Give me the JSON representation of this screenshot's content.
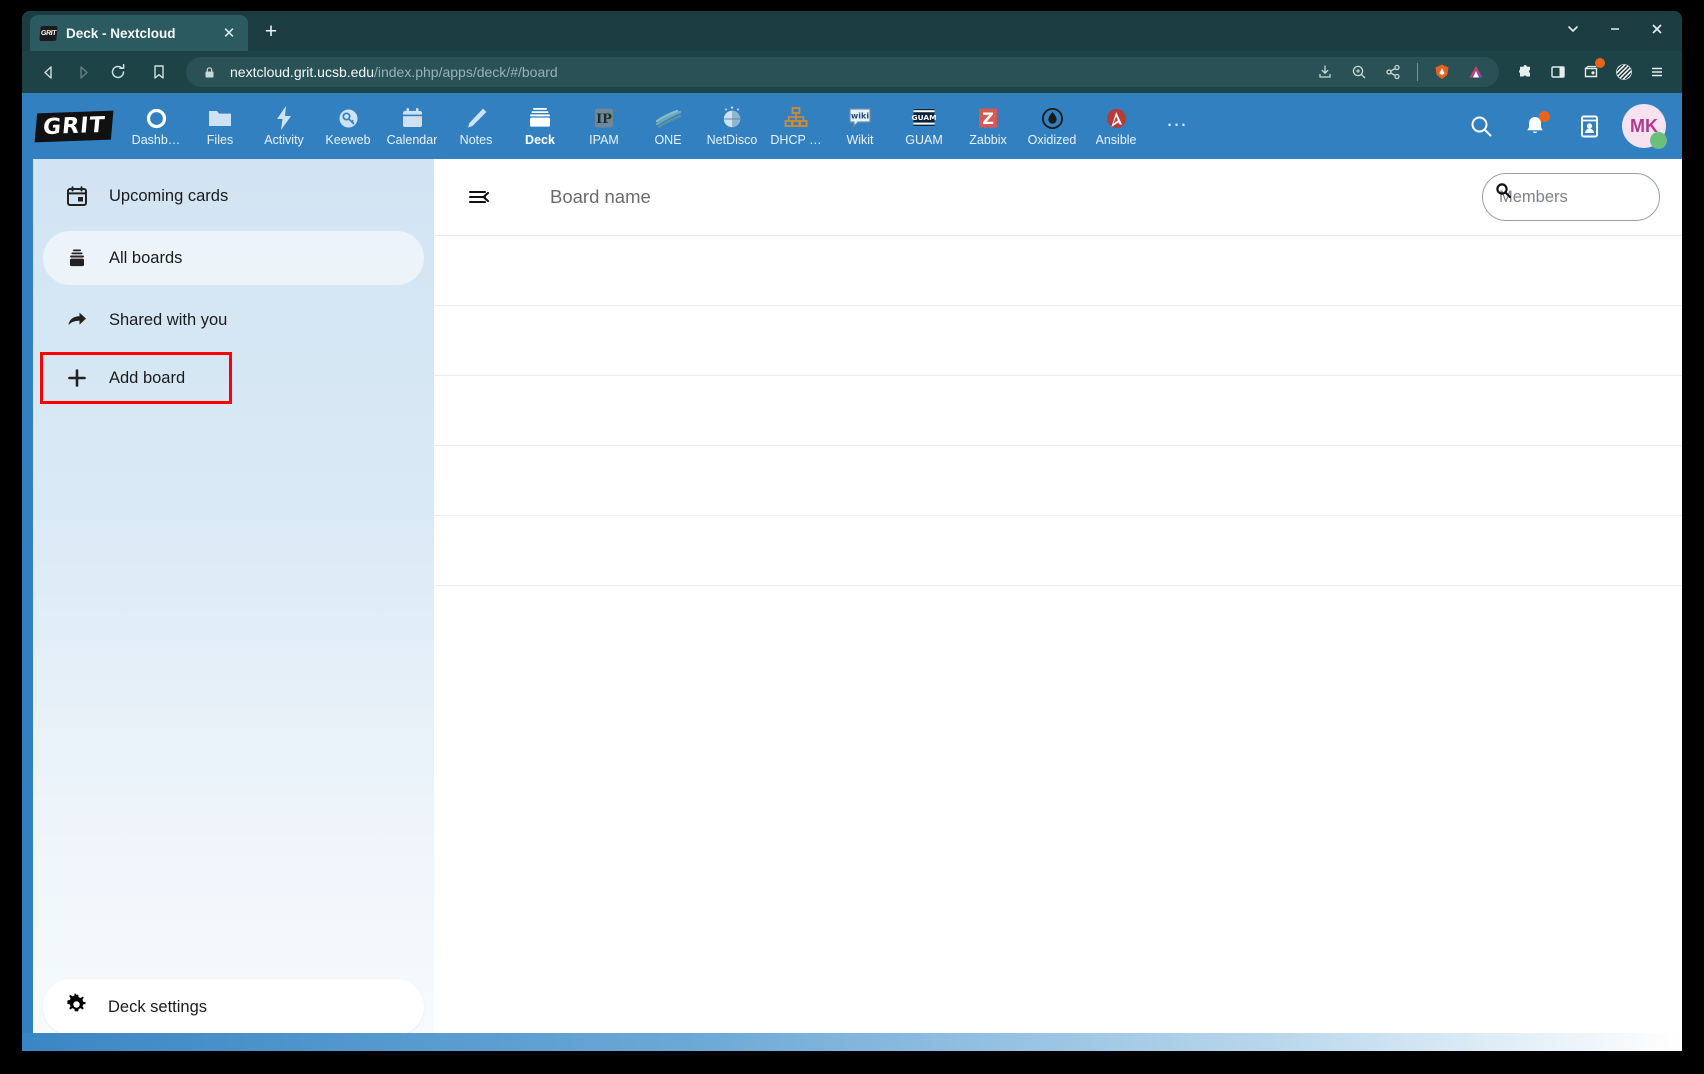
{
  "window": {
    "controls": {
      "expand": "⌄",
      "minimize": "—",
      "close": "✕"
    }
  },
  "browser": {
    "tab": {
      "favicon_text": "GRIT",
      "title": "Deck - Nextcloud",
      "close": "✕"
    },
    "new_tab_label": "+",
    "nav": {
      "back": "back-icon",
      "forward": "forward-icon",
      "reload": "reload-icon",
      "bookmark": "bookmark-icon"
    },
    "url": {
      "domain": "nextcloud.grit.ucsb.edu",
      "path": "/index.php/apps/deck/#/board",
      "lock": "lock-icon"
    },
    "url_actions": [
      "install-icon",
      "zoom-icon",
      "share-icon",
      "brave-rewards-icon",
      "brave-shields-icon"
    ],
    "toolbar_icons": [
      "extensions-icon",
      "sidebar-icon",
      "wallet-icon",
      "leo-icon",
      "menu-icon"
    ]
  },
  "nextcloud": {
    "logo": "GRIT",
    "apps": [
      {
        "label": "Dashb…",
        "icon": "dashboard-icon",
        "active": false
      },
      {
        "label": "Files",
        "icon": "files-icon",
        "active": false
      },
      {
        "label": "Activity",
        "icon": "activity-icon",
        "active": false
      },
      {
        "label": "Keeweb",
        "icon": "keeweb-icon",
        "active": false
      },
      {
        "label": "Calendar",
        "icon": "calendar-icon",
        "active": false
      },
      {
        "label": "Notes",
        "icon": "notes-icon",
        "active": false
      },
      {
        "label": "Deck",
        "icon": "deck-icon",
        "active": true
      },
      {
        "label": "IPAM",
        "icon": "ipam-icon",
        "active": false
      },
      {
        "label": "ONE",
        "icon": "one-icon",
        "active": false
      },
      {
        "label": "NetDisco",
        "icon": "netdisco-icon",
        "active": false
      },
      {
        "label": "DHCP …",
        "icon": "dhcp-icon",
        "active": false
      },
      {
        "label": "Wikit",
        "icon": "wikit-icon",
        "active": false
      },
      {
        "label": "GUAM",
        "icon": "guam-icon",
        "active": false
      },
      {
        "label": "Zabbix",
        "icon": "zabbix-icon",
        "active": false
      },
      {
        "label": "Oxidized",
        "icon": "oxidized-icon",
        "active": false
      },
      {
        "label": "Ansible",
        "icon": "ansible-icon",
        "active": false
      }
    ],
    "more_apps": "…",
    "header_right": {
      "search": "search-icon",
      "notifications": "bell-icon",
      "contacts": "contacts-icon",
      "avatar_initials": "MK",
      "avatar_status": "online"
    }
  },
  "sidebar": {
    "items": [
      {
        "label": "Upcoming cards",
        "icon": "calendar-icon",
        "selected": false
      },
      {
        "label": "All boards",
        "icon": "archive-icon",
        "selected": true
      },
      {
        "label": "Shared with you",
        "icon": "share-arrow-icon",
        "selected": false
      },
      {
        "label": "Add board",
        "icon": "plus-icon",
        "selected": false,
        "highlighted": true
      }
    ],
    "footer": {
      "label": "Deck settings",
      "icon": "gear-icon"
    }
  },
  "main": {
    "collapse_icon": "collapse-sidebar-icon",
    "board_name_placeholder": "Board name",
    "members": {
      "placeholder": "Members",
      "value": "",
      "icon": "search-icon"
    },
    "row_count": 6
  },
  "colors": {
    "browser_chrome": "#1e4347",
    "nextcloud_blue": "#3380c0",
    "sidebar_bg": "#d2e4f3",
    "highlight_red": "#ff0000",
    "avatar_bg": "#f7e3ef",
    "avatar_fg": "#b5378f"
  }
}
